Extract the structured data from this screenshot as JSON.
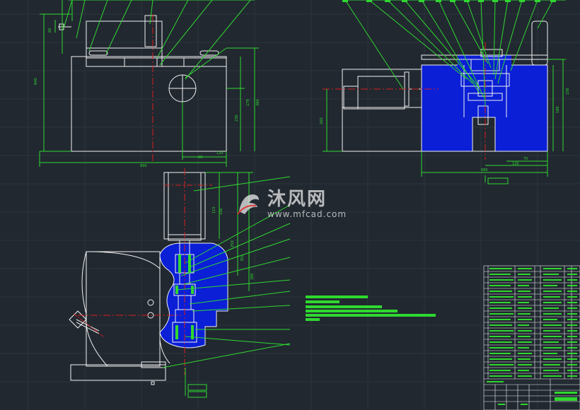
{
  "drawing": {
    "background": "#212830",
    "line_color": "#f2f2f2",
    "leader_color": "#2fd82f",
    "section_fill": "#0a1fd6",
    "centerline_color": "#d81e1e",
    "dimension_color": "#2fd82f"
  },
  "watermark": {
    "title": "沐风网",
    "url": "www.mfcad.com",
    "logo": "mfcad-logo-icon"
  }
}
